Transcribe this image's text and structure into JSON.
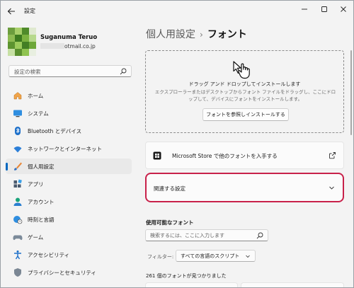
{
  "window": {
    "title": "設定"
  },
  "profile": {
    "name": "Suganuma Teruo",
    "email_visible": "otmail.co.jp"
  },
  "search": {
    "placeholder": "設定の検索"
  },
  "sidebar": {
    "items": [
      {
        "label": "ホーム",
        "icon": "home-icon",
        "active": false
      },
      {
        "label": "システム",
        "icon": "monitor-icon",
        "active": false
      },
      {
        "label": "Bluetooth とデバイス",
        "icon": "bluetooth-icon",
        "active": false
      },
      {
        "label": "ネットワークとインターネット",
        "icon": "wifi-icon",
        "active": false
      },
      {
        "label": "個人用設定",
        "icon": "brush-icon",
        "active": true
      },
      {
        "label": "アプリ",
        "icon": "apps-icon",
        "active": false
      },
      {
        "label": "アカウント",
        "icon": "person-icon",
        "active": false
      },
      {
        "label": "時刻と言語",
        "icon": "globe-clock-icon",
        "active": false
      },
      {
        "label": "ゲーム",
        "icon": "gamepad-icon",
        "active": false
      },
      {
        "label": "アクセシビリティ",
        "icon": "accessibility-icon",
        "active": false
      },
      {
        "label": "プライバシーとセキュリティ",
        "icon": "shield-icon",
        "active": false
      }
    ]
  },
  "breadcrumb": {
    "parent": "個人用設定",
    "separator": "›",
    "current": "フォント"
  },
  "drop_zone": {
    "title": "ドラッグ アンド ドロップしてインストールします",
    "description": "エクスプローラーまたはデスクトップからフォント ファイルをドラッグし、ここにドロップして、デバイスにフォントをインストールします。",
    "button_label": "フォントを参照しインストールする"
  },
  "store_link": {
    "label": "Microsoft Store で他のフォントを入手する"
  },
  "related": {
    "label": "関連する設定"
  },
  "available_fonts": {
    "heading": "使用可能なフォント",
    "search_placeholder": "検索するには、ここに入力します",
    "filter_label": "フィルター:",
    "filter_value": "すべての言語のスクリプト",
    "count_text": "261 個のフォントが見つかりました"
  },
  "colors": {
    "accent": "#0067c0",
    "highlight_border": "#c8214a",
    "background": "#f3f3f3",
    "card": "#fbfbfb"
  }
}
